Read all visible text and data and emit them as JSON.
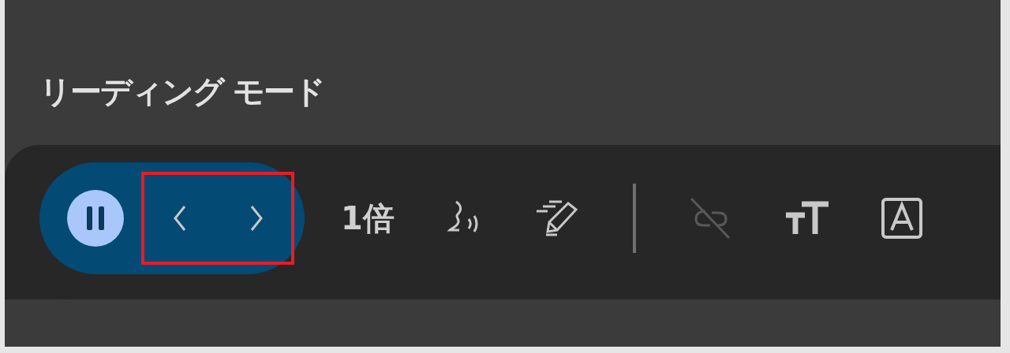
{
  "title": "リーディング モード",
  "player": {
    "playing": true,
    "page_nav_highlighted": true
  },
  "speed": "1倍",
  "tools": [
    {
      "kind": "voice",
      "disabled": false
    },
    {
      "kind": "highlight",
      "disabled": false
    },
    {
      "kind": "link-off",
      "disabled": true
    },
    {
      "kind": "text-size",
      "disabled": false
    },
    {
      "kind": "text-box",
      "disabled": false
    }
  ]
}
